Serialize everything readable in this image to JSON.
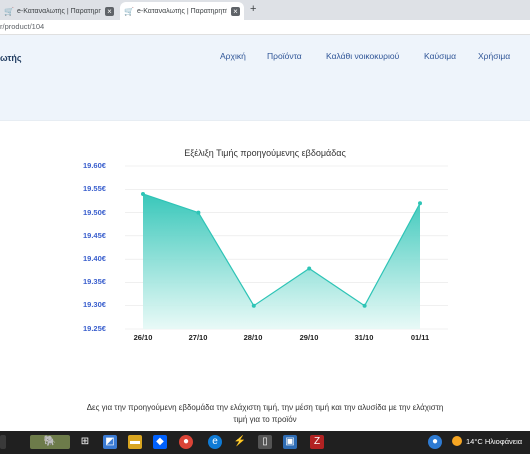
{
  "browser": {
    "tabs": [
      {
        "title": "e-Καταναλωτής | Παρατηρητήρι"
      },
      {
        "title": "e-Καταναλωτής | Παρατηρητήριο"
      }
    ],
    "url": "r/product/104"
  },
  "site": {
    "brand": "ωτής",
    "nav": [
      {
        "label": "Αρχική"
      },
      {
        "label": "Προϊόντα"
      },
      {
        "label": "Καλάθι νοικοκυριού"
      },
      {
        "label": "Καύσιμα"
      },
      {
        "label": "Χρήσιμα"
      }
    ]
  },
  "chart_data": {
    "type": "area",
    "title": "Εξέλιξη Τιμής προηγούμενης εβδομάδας",
    "categories": [
      "26/10",
      "27/10",
      "28/10",
      "29/10",
      "31/10",
      "01/11"
    ],
    "values": [
      19.54,
      19.5,
      19.3,
      19.38,
      19.3,
      19.52
    ],
    "yticks": [
      "19.60€",
      "19.55€",
      "19.50€",
      "19.45€",
      "19.40€",
      "19.35€",
      "19.30€",
      "19.25€"
    ],
    "ylim": [
      19.25,
      19.6
    ],
    "colors": {
      "line": "#2ec4b6",
      "fill_top": "#2ec4b6",
      "fill_bottom": "#e6f9f6"
    },
    "grid": true
  },
  "description": "Δες για την προηγούμενη εβδομάδα την ελάχιστη τιμή, την μέση τιμή και την αλυσίδα με την ελάχιστη τιμή για το προϊόν",
  "taskbar": {
    "weather": "14°C Ηλιοφάνεια",
    "icons": [
      "windows-icon",
      "elephant-wallpaper-icon",
      "task-view-icon",
      "widgets-icon",
      "explorer-icon",
      "dropbox-icon",
      "chrome-icon",
      "edge-icon",
      "terminal-icon",
      "app-icon",
      "filezilla-icon"
    ]
  }
}
